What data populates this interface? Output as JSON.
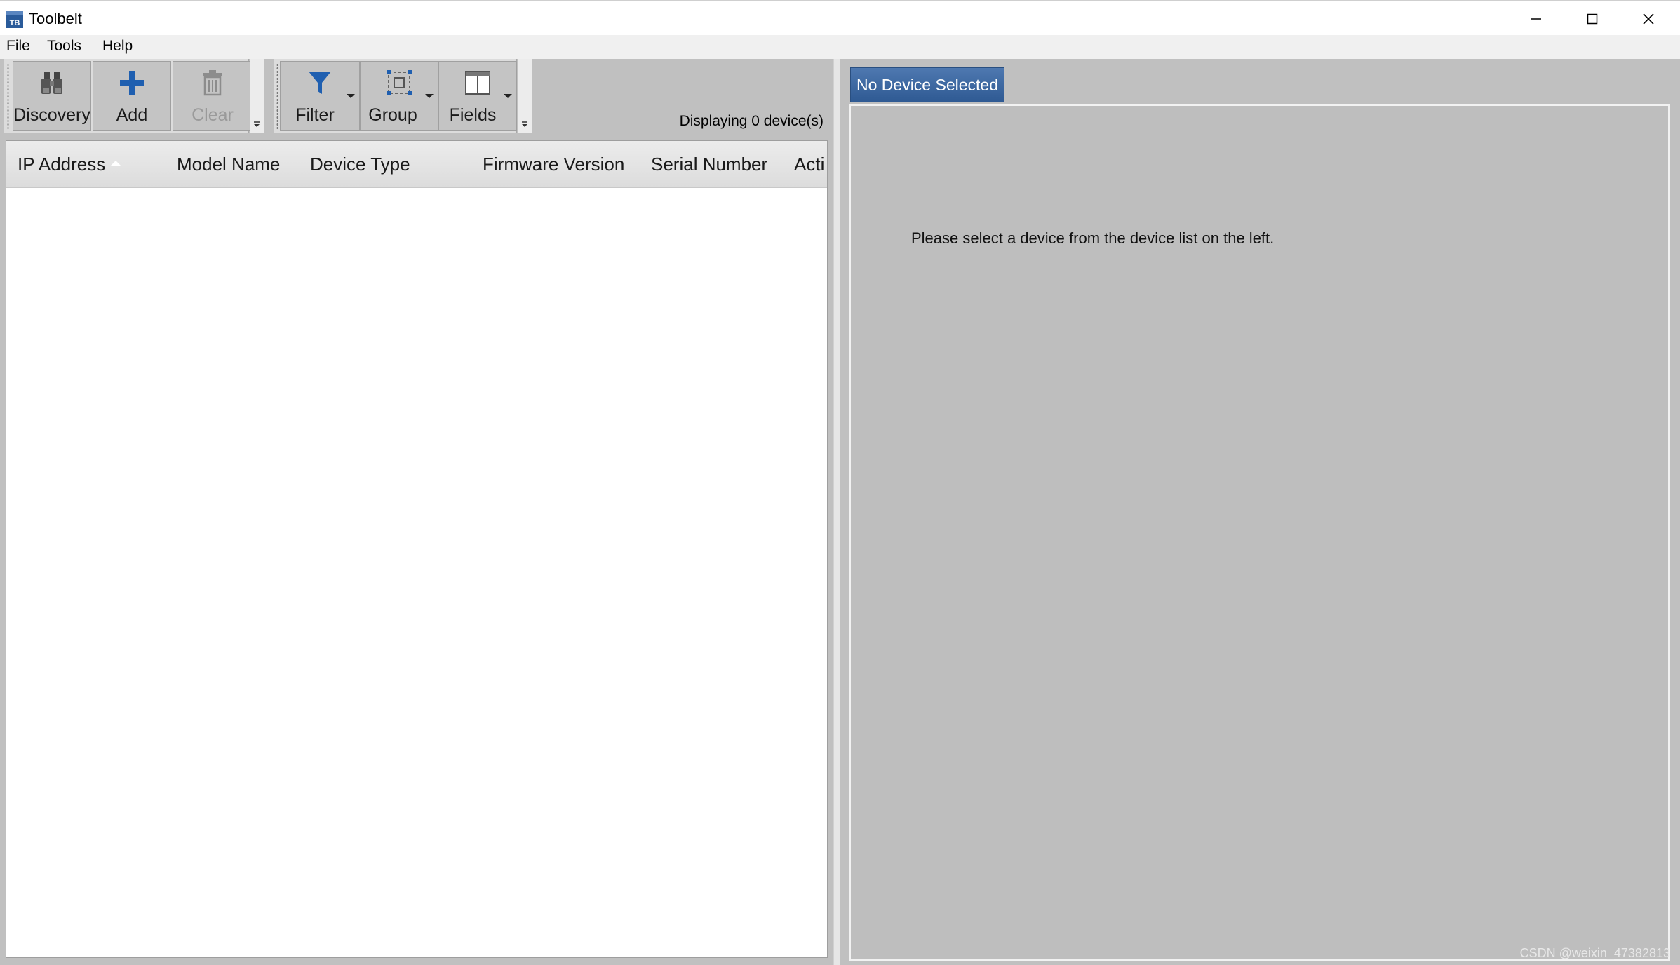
{
  "window": {
    "title": "Toolbelt",
    "icon_text": "TB",
    "controls": [
      "minimize",
      "maximize",
      "close"
    ]
  },
  "menu": [
    "File",
    "Tools",
    "Help"
  ],
  "toolbar": {
    "group1": [
      {
        "label": "Discovery",
        "icon": "binoculars-icon",
        "enabled": true
      },
      {
        "label": "Add",
        "icon": "plus-icon",
        "enabled": true
      },
      {
        "label": "Clear",
        "icon": "trash-icon",
        "enabled": false
      }
    ],
    "group2": [
      {
        "label": "Filter",
        "icon": "funnel-icon",
        "dropdown": true
      },
      {
        "label": "Group",
        "icon": "group-select-icon",
        "dropdown": true
      },
      {
        "label": "Fields",
        "icon": "columns-icon",
        "dropdown": true
      }
    ],
    "status": "Displaying 0 device(s)"
  },
  "table": {
    "columns": [
      "IP Address",
      "Model Name",
      "Device Type",
      "Firmware Version",
      "Serial Number",
      "Acti"
    ],
    "sort_column": "IP Address",
    "rows": []
  },
  "details": {
    "tab_label": "No Device Selected",
    "message": "Please select a device from the device list on the left."
  },
  "watermark": "CSDN @weixin_47382813",
  "colors": {
    "accent": "#2f5a93",
    "icon_blue": "#1f5fb0",
    "pane_bg": "#c0c0c0"
  }
}
